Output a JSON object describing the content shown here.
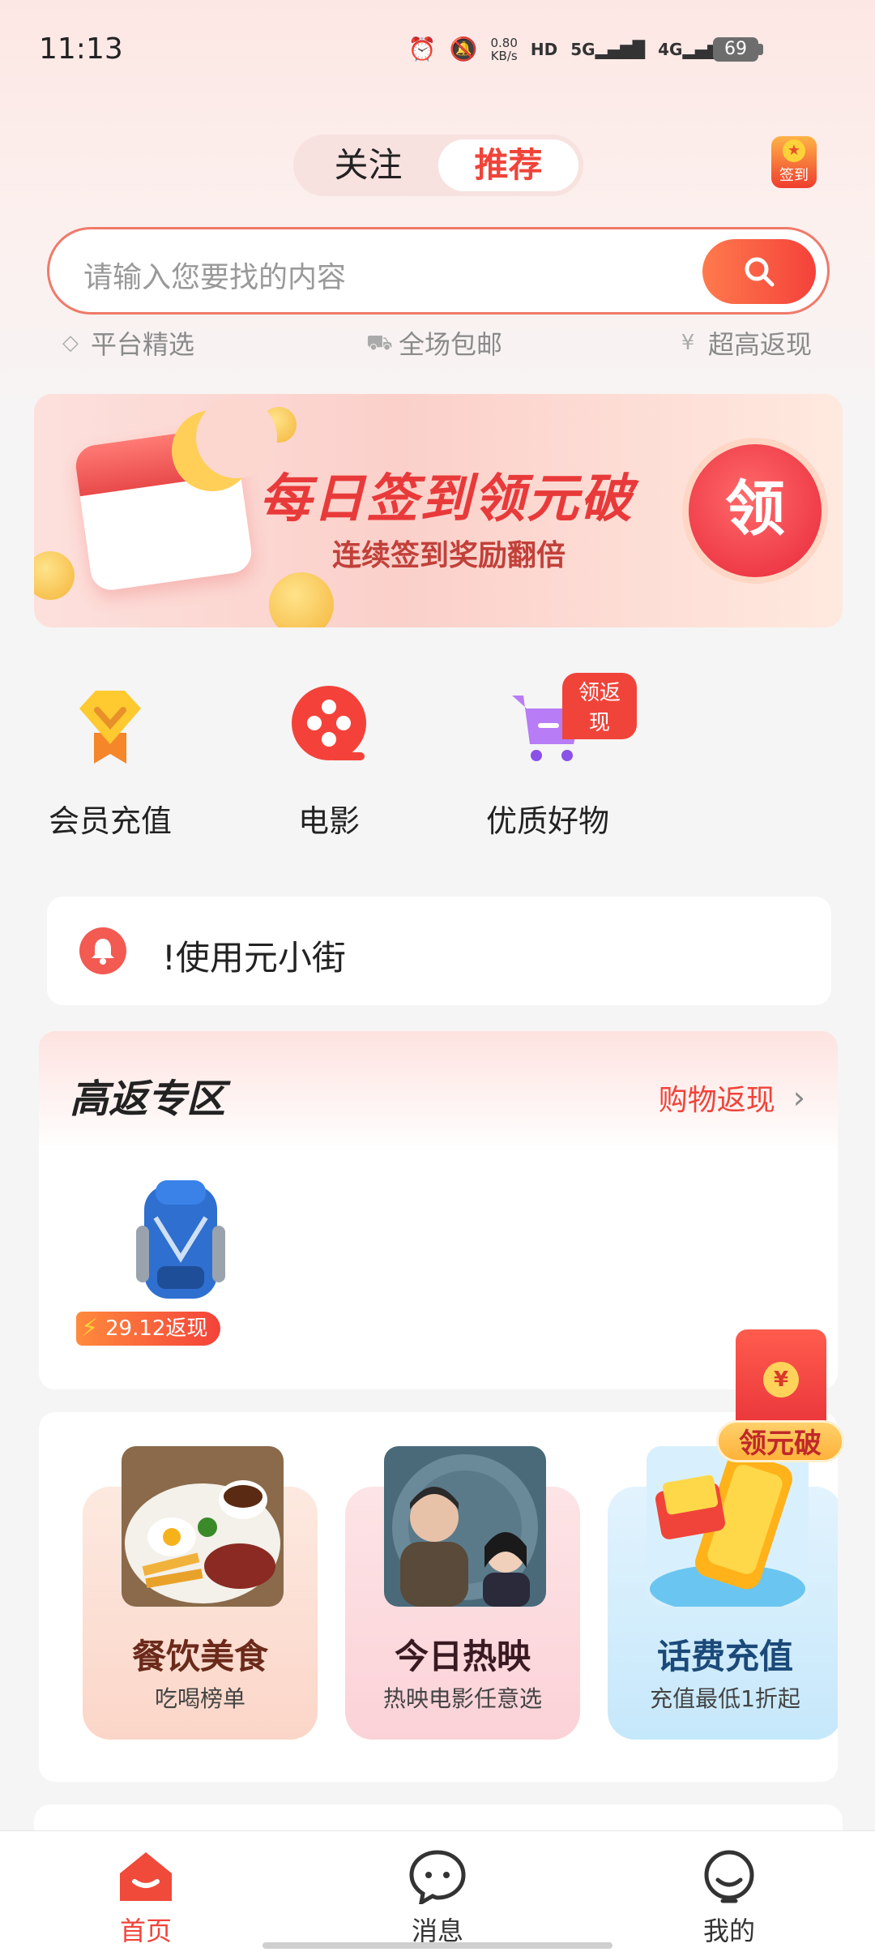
{
  "status_bar": {
    "time": "11:13",
    "net_speed_value": "0.80",
    "net_speed_unit": "KB/s",
    "hd_label": "HD",
    "sim1": "5G",
    "sim2": "4G",
    "battery": "69"
  },
  "header": {
    "tabs": [
      "关注",
      "推荐"
    ],
    "active_tab": "推荐",
    "checkin_label": "签到"
  },
  "search": {
    "placeholder": "请输入您要找的内容"
  },
  "features": [
    "平台精选",
    "全场包邮",
    "超高返现"
  ],
  "banner": {
    "title": "每日签到领元破",
    "subtitle": "连续签到奖励翻倍",
    "cta": "领"
  },
  "quick_actions": [
    {
      "label": "会员充值",
      "icon": "vip-diamond-icon"
    },
    {
      "label": "电影",
      "icon": "film-reel-icon"
    },
    {
      "label": "优质好物",
      "icon": "shopping-cart-icon",
      "badge": "领返现"
    }
  ],
  "notice": {
    "text": "!使用元小街"
  },
  "high_return": {
    "title": "高返专区",
    "link": "购物返现",
    "products": [
      {
        "cashback": "29.12返现"
      }
    ]
  },
  "floating_packet": {
    "symbol": "¥",
    "label": "领元破"
  },
  "categories": [
    {
      "title": "餐饮美食",
      "subtitle": "吃喝榜单",
      "title_color": "#6b2a1a"
    },
    {
      "title": "今日热映",
      "subtitle": "热映电影任意选",
      "title_color": "#3a1a22"
    },
    {
      "title": "话费充值",
      "subtitle": "充值最低1折起",
      "title_color": "#1b4a7a"
    }
  ],
  "bottom_nav": [
    {
      "label": "首页",
      "active": true
    },
    {
      "label": "消息",
      "active": false
    },
    {
      "label": "我的",
      "active": false
    }
  ],
  "colors": {
    "accent": "#f0443a",
    "background": "#f5f5f5"
  }
}
